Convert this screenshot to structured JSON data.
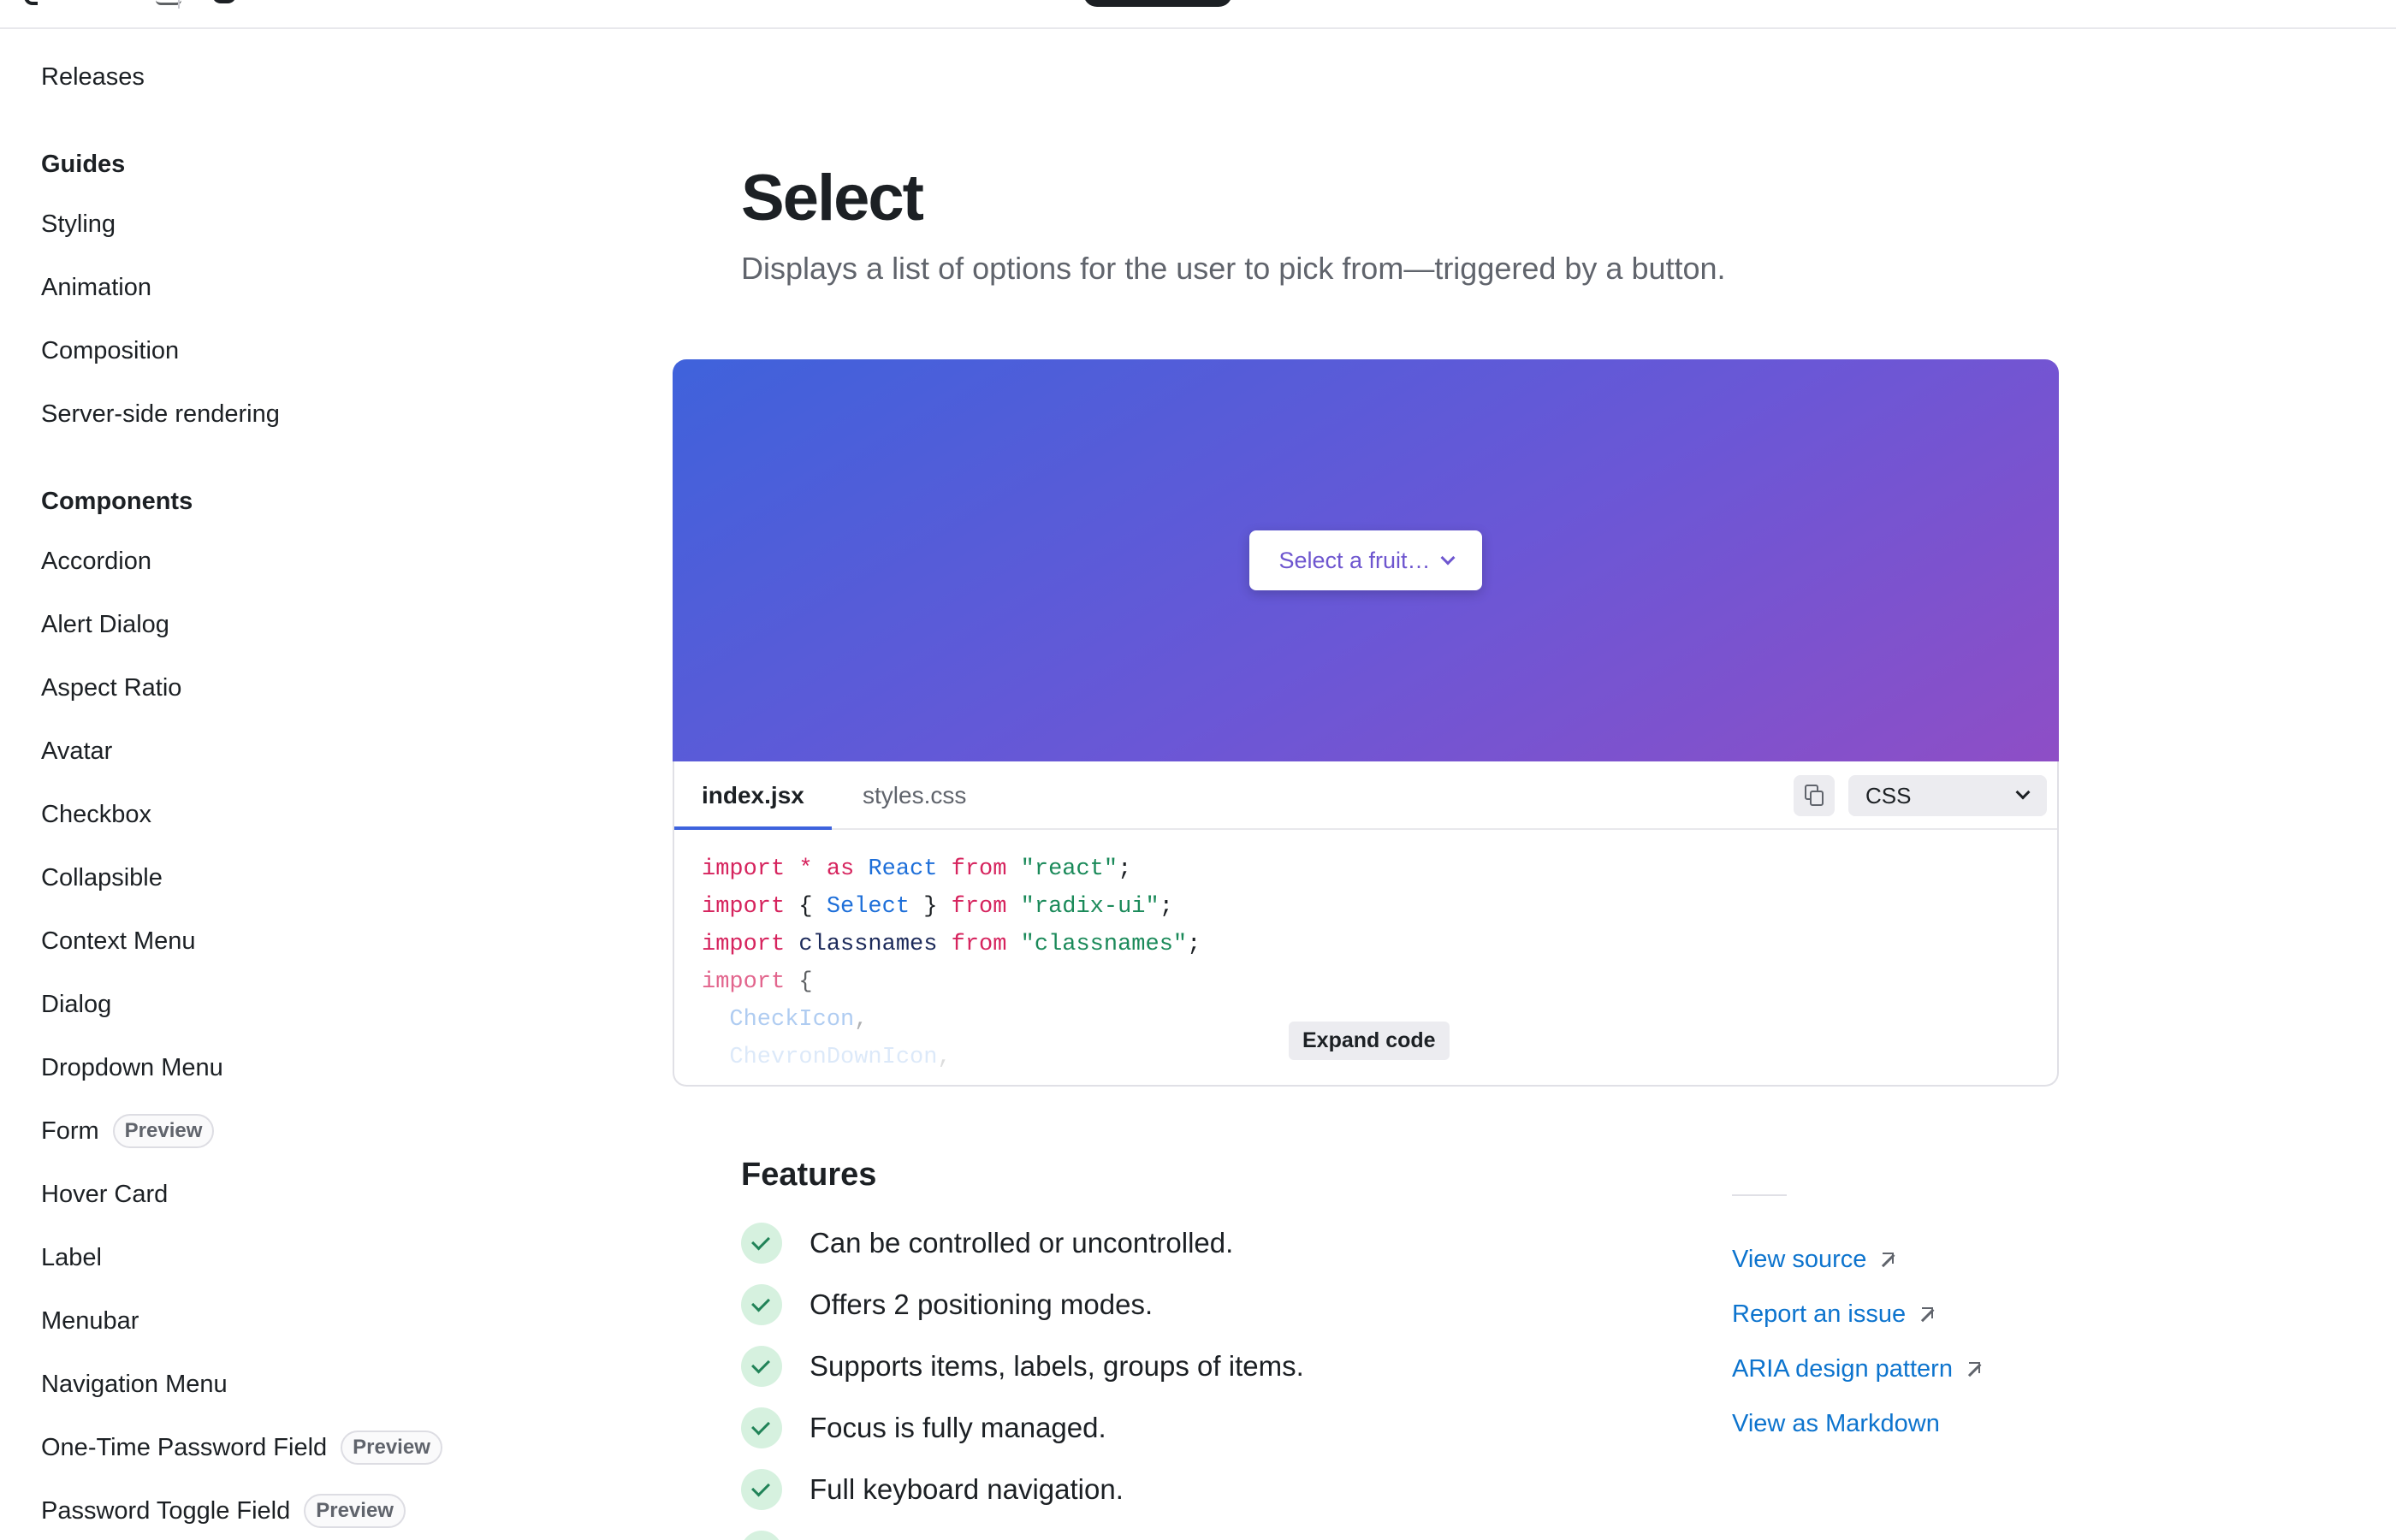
{
  "sidebar": {
    "top_item": "Releases",
    "guides_heading": "Guides",
    "guides": [
      "Styling",
      "Animation",
      "Composition",
      "Server-side rendering"
    ],
    "components_heading": "Components",
    "components": [
      {
        "label": "Accordion"
      },
      {
        "label": "Alert Dialog"
      },
      {
        "label": "Aspect Ratio"
      },
      {
        "label": "Avatar"
      },
      {
        "label": "Checkbox"
      },
      {
        "label": "Collapsible"
      },
      {
        "label": "Context Menu"
      },
      {
        "label": "Dialog"
      },
      {
        "label": "Dropdown Menu"
      },
      {
        "label": "Form",
        "badge": "Preview"
      },
      {
        "label": "Hover Card"
      },
      {
        "label": "Label"
      },
      {
        "label": "Menubar"
      },
      {
        "label": "Navigation Menu"
      },
      {
        "label": "One-Time Password Field",
        "badge": "Preview"
      },
      {
        "label": "Password Toggle Field",
        "badge": "Preview"
      }
    ]
  },
  "main": {
    "title": "Select",
    "description": "Displays a list of options for the user to pick from—triggered by a button.",
    "demo": {
      "select_placeholder": "Select a fruit…"
    },
    "code": {
      "tabs": [
        "index.jsx",
        "styles.css"
      ],
      "language": "CSS",
      "expand_label": "Expand code"
    },
    "features_title": "Features",
    "features": [
      "Can be controlled or uncontrolled.",
      "Offers 2 positioning modes.",
      "Supports items, labels, groups of items.",
      "Focus is fully managed.",
      "Full keyboard navigation."
    ]
  },
  "links": [
    "View source",
    "Report an issue",
    "ARIA design pattern",
    "View as Markdown"
  ],
  "colors": {
    "accent": "#3e63dd",
    "link": "#0d74ce",
    "demo_gradient_start": "#3f62db",
    "demo_gradient_end": "#8e4ec6",
    "check_bg": "#d6f1df"
  }
}
